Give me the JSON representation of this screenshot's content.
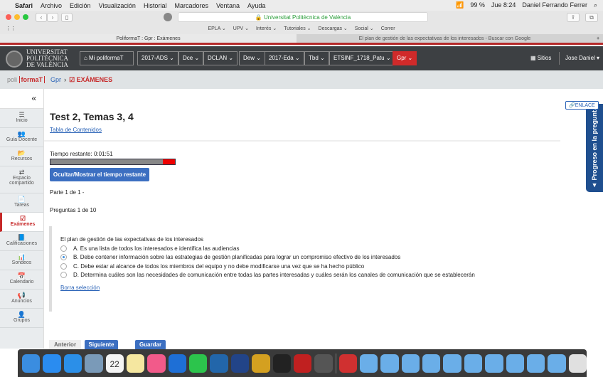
{
  "menubar": {
    "app": "Safari",
    "items": [
      "Archivo",
      "Edición",
      "Visualización",
      "Historial",
      "Marcadores",
      "Ventana",
      "Ayuda"
    ],
    "battery": "99 %",
    "clock": "Jue 8:24",
    "user": "Daniel Ferrando Ferrer"
  },
  "browser": {
    "url": "Universitat Politècnica de València",
    "favorites": [
      "EPLA ⌄",
      "UPV ⌄",
      "Interés ⌄",
      "Tutoriales ⌄",
      "Descargas ⌄",
      "Social ⌄",
      "Correr"
    ],
    "tabs": [
      "PoliformaT : Gpr : Exámenes",
      "El plan de gestión de las expectativas de los interesados - Buscar con Google"
    ]
  },
  "header": {
    "logo": [
      "UNIVERSITAT",
      "POLITÈCNICA",
      "DE VALÈNCIA"
    ],
    "sites": [
      "⌂ Mi poliformaT",
      "2017-ADS ⌄",
      "Dce ⌄",
      "DCLAN ⌄",
      "Dew ⌄",
      "2017-Eda ⌄",
      "Tbd ⌄",
      "ETSINF_1718_Patu ⌄",
      "Gpr ⌄"
    ],
    "sitios": "Sitios",
    "user": "Jose Daniel ▾"
  },
  "breadcrumb": {
    "poli": "poli",
    "formaT": "formaT",
    "site": "Gpr",
    "sep": "›",
    "page": "EXÁMENES"
  },
  "sidebar": {
    "collapse": "«",
    "items": [
      {
        "icon": "☰",
        "label": "Inicio"
      },
      {
        "icon": "👥",
        "label": "Guía Docente"
      },
      {
        "icon": "📂",
        "label": "Recursos"
      },
      {
        "icon": "⇄",
        "label": "Espacio compartido"
      },
      {
        "icon": "📄",
        "label": "Tareas"
      },
      {
        "icon": "☑",
        "label": "Exámenes"
      },
      {
        "icon": "📘",
        "label": "Calificaciones"
      },
      {
        "icon": "📊",
        "label": "Sondeos"
      },
      {
        "icon": "📅",
        "label": "Calendario"
      },
      {
        "icon": "📢",
        "label": "Anuncios"
      },
      {
        "icon": "👤",
        "label": "Grupos"
      }
    ]
  },
  "main": {
    "title": "Test 2, Temas 3, 4",
    "toc": "Tabla de Contenidos",
    "link": "ENLACE",
    "progress_tab": "▲ Progreso en la pregunta",
    "time_label": "Tiempo restante: 0:01:51",
    "time_elapsed_fraction": 0.9,
    "toggle_time": "Ocultar/Mostrar el tiempo restante",
    "part": "Parte 1 de 1 -",
    "questions": "Preguntas 1 de 10",
    "question": "El plan de gestión de las expectativas de los interesados",
    "options": [
      {
        "text": "A. Es una lista de todos los interesados e identifica las audiencias",
        "selected": false
      },
      {
        "text": "B. Debe contener información sobre las estrategias de gestión planificadas para lograr un compromiso efectivo de los interesados",
        "selected": true
      },
      {
        "text": "C. Debe estar al alcance de todos los miembros del equipo y no debe modificarse una vez que se ha hecho público",
        "selected": false
      },
      {
        "text": "D. Determina cuáles son las necesidades de comunicación entre todas las partes interesadas y cuáles serán los canales de comunicación que se establecerán",
        "selected": false
      }
    ],
    "clear": "Borra selección",
    "prev": "Anterior",
    "next": "Siguiente",
    "save": "Guardar"
  },
  "dock": {
    "calendar_day": "22",
    "colors": [
      "#3a8de0",
      "#2a8cf0",
      "#2b8fe8",
      "#7a9ab8",
      "#f4f4f4",
      "#f5e7a0",
      "#f25a8a",
      "#1e6fd6",
      "#2cc44c",
      "#2266aa",
      "#224488",
      "#d4a020",
      "#222222",
      "#c02020",
      "#555555",
      "#d03030",
      "#6aaee8",
      "#6aaee8",
      "#6aaee8",
      "#6aaee8",
      "#6aaee8",
      "#6aaee8",
      "#6aaee8",
      "#6aaee8",
      "#6aaee8",
      "#6aaee8",
      "#e0e0e0"
    ]
  }
}
